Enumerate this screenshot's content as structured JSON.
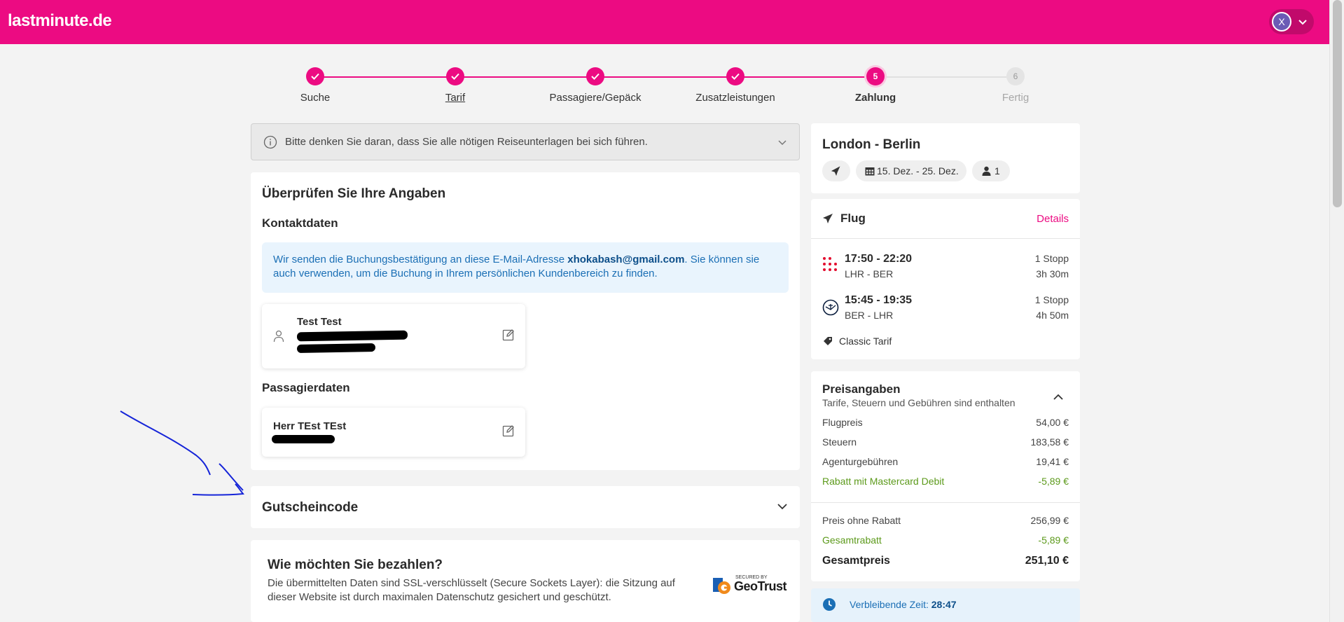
{
  "header": {
    "logo": "lastminute.de",
    "user_initial": "X"
  },
  "stepper": {
    "steps": [
      {
        "label": "Suche",
        "state": "done"
      },
      {
        "label": "Tarif",
        "state": "done"
      },
      {
        "label": "Passagiere/Gepäck",
        "state": "done"
      },
      {
        "label": "Zusatzleistungen",
        "state": "done"
      },
      {
        "label": "Zahlung",
        "state": "current",
        "number": "5"
      },
      {
        "label": "Fertig",
        "state": "todo",
        "number": "6"
      }
    ]
  },
  "notice": {
    "text": "Bitte denken Sie daran, dass Sie alle nötigen Reiseunterlagen bei sich führen."
  },
  "review": {
    "title": "Überprüfen Sie Ihre Angaben",
    "contact_title": "Kontaktdaten",
    "email_info_before": "Wir senden die Buchungsbestätigung an diese E-Mail-Adresse ",
    "email": "xhokabash@gmail.com",
    "email_info_after": ". Sie können sie auch verwenden, um die Buchung in Ihrem persönlichen Kundenbereich zu finden.",
    "contact_name": "Test Test",
    "passenger_title": "Passagierdaten",
    "passenger_name": "Herr TEst TEst"
  },
  "voucher": {
    "title": "Gutscheincode"
  },
  "payment": {
    "title": "Wie möchten Sie bezahlen?",
    "text": "Die übermittelten Daten sind SSL-verschlüsselt (Secure Sockets Layer): die Sitzung auf dieser Website ist durch maximalen Datenschutz gesichert und geschützt.",
    "badge_secured": "SECURED BY",
    "badge_name": "GeoTrust"
  },
  "trip": {
    "title": "London - Berlin",
    "dates": "15. Dez. - 25. Dez.",
    "passengers": "1"
  },
  "flight": {
    "title": "Flug",
    "details_link": "Details",
    "segments": [
      {
        "time": "17:50 - 22:20",
        "route": "LHR - BER",
        "stops": "1 Stopp",
        "duration": "3h 30m"
      },
      {
        "time": "15:45 - 19:35",
        "route": "BER - LHR",
        "stops": "1 Stopp",
        "duration": "4h 50m"
      }
    ],
    "tarif": "Classic Tarif"
  },
  "prices": {
    "title": "Preisangaben",
    "subtitle": "Tarife, Steuern und Gebühren sind enthalten",
    "rows": [
      {
        "label": "Flugpreis",
        "amount": "54,00 €"
      },
      {
        "label": "Steuern",
        "amount": "183,58 €"
      },
      {
        "label": "Agenturgebühren",
        "amount": "19,41 €"
      },
      {
        "label": "Rabatt mit Mastercard Debit",
        "amount": "-5,89 €"
      }
    ],
    "without_discount_label": "Preis ohne Rabatt",
    "without_discount_amount": "256,99 €",
    "total_discount_label": "Gesamtrabatt",
    "total_discount_amount": "-5,89 €",
    "total_label": "Gesamtpreis",
    "total_amount": "251,10 €"
  },
  "timer": {
    "label": "Verbleibende Zeit: ",
    "value": "28:47"
  },
  "colors": {
    "brand": "#ec0b82",
    "info_blue": "#1b6fb5",
    "discount_green": "#5c9a1b"
  }
}
